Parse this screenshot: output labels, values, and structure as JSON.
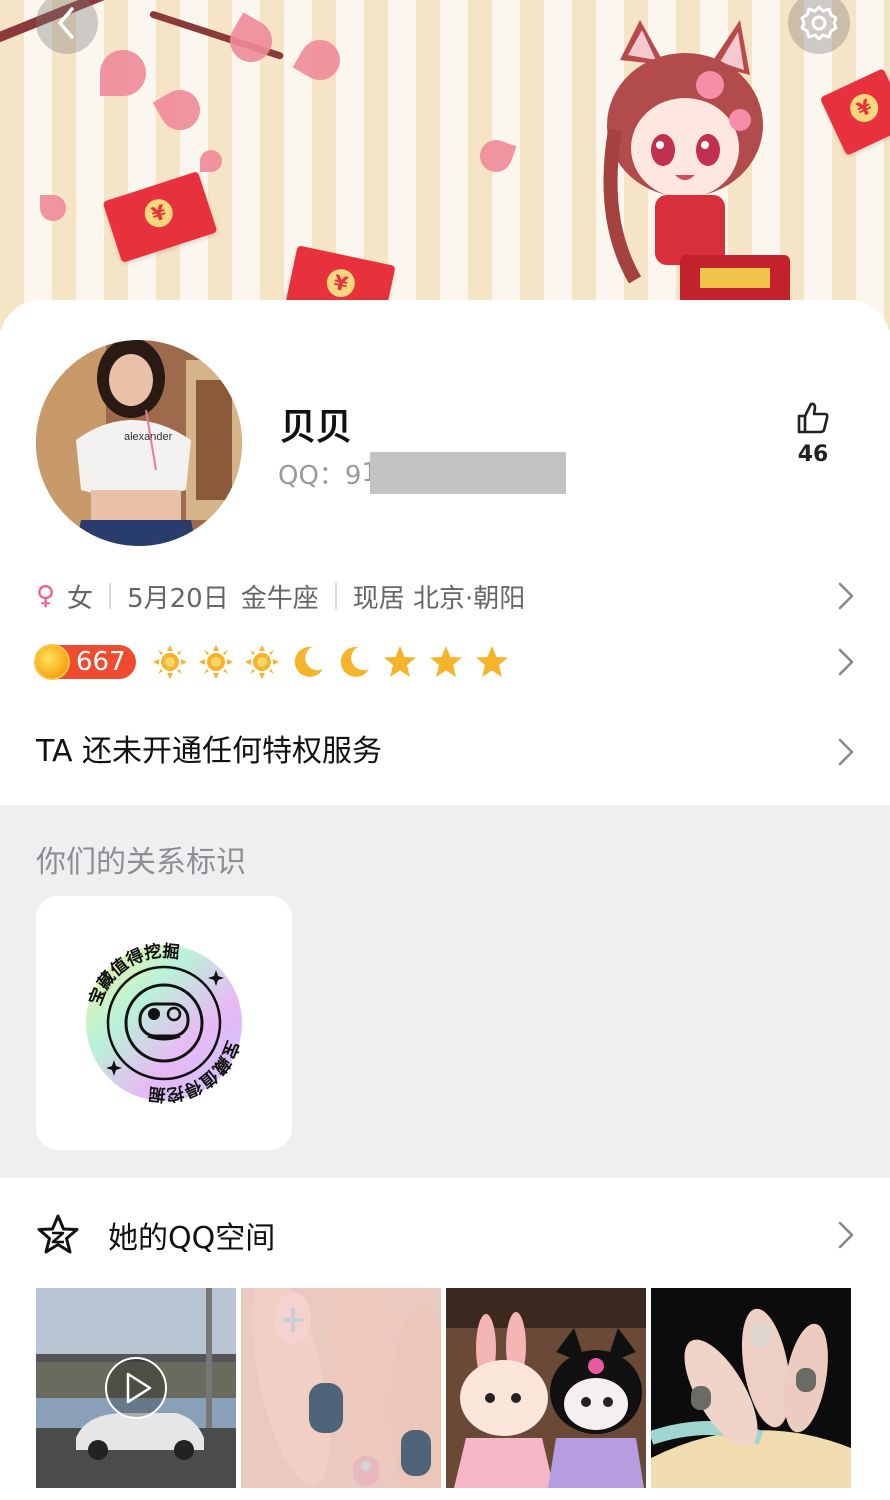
{
  "header": {
    "back_icon": "chevron-left-icon",
    "settings_icon": "gear-icon"
  },
  "profile": {
    "nickname": "贝贝",
    "qq_label": "QQ：9",
    "qq_digit": "1",
    "likes": "46",
    "gender_symbol": "♀",
    "gender": "女",
    "birthday": "5月20日",
    "zodiac": "金牛座",
    "residence": "现居 北京·朝阳"
  },
  "level": {
    "value": "667",
    "icons": [
      "sun",
      "sun",
      "sun",
      "moon",
      "moon",
      "star",
      "star",
      "star"
    ]
  },
  "privilege": {
    "text": "TA 还未开通任何特权服务"
  },
  "relationship": {
    "title": "你们的关系标识",
    "badge_text": "宝藏值得挖掘"
  },
  "qzone": {
    "title": "她的QQ空间",
    "photos": [
      "video-street",
      "nails-blue",
      "plush-dolls",
      "nails-grey"
    ]
  },
  "colors": {
    "accent_red": "#ef4b31",
    "gender_pink": "#f25a8f",
    "gray_bg": "#efeff2"
  }
}
